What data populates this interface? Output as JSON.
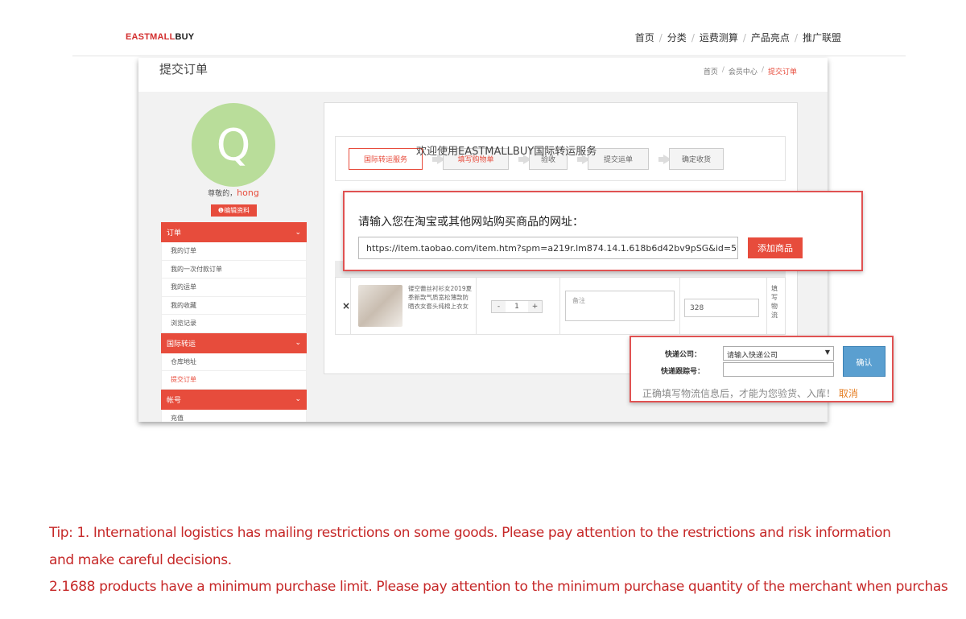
{
  "brand": {
    "part1": "EASTMALL",
    "part2": "BUY",
    "accent": "#d32f2f"
  },
  "nav": {
    "items": [
      "首页",
      "分类",
      "运费测算",
      "产品亮点",
      "推广联盟"
    ]
  },
  "shot": {
    "page_title": "提交订单",
    "breadcrumb": [
      "首页",
      "会员中心",
      "提交订单"
    ],
    "avatar_letter": "Q",
    "greeting": "尊敬的，",
    "username": "hong",
    "edit_button": "❶编辑资料",
    "sidebar": {
      "orders_header": "订单",
      "orders_items": [
        "我的订单",
        "我的一次付款订单",
        "我的运单",
        "我的收藏",
        "浏览记录"
      ],
      "forward_header": "国际转运",
      "forward_items": [
        "仓库地址",
        "提交订单"
      ],
      "account_header": "帐号",
      "account_items": [
        "充值"
      ]
    },
    "welcome": "欢迎使用EASTMALLBUY国际转运服务",
    "steps": [
      "国际转运服务",
      "填写购物单",
      "验收",
      "提交运单",
      "确定收货"
    ],
    "product": {
      "name": "镂空蕾丝衬衫女2019夏季新款气质宽松薄款防晒衣女套头纯棉上衣女",
      "qty": "1",
      "minus": "-",
      "plus": "+",
      "remark_placeholder": "备注",
      "price": "328",
      "fill_logistics": "填写物流",
      "remove": "×"
    }
  },
  "url_popup": {
    "question": "请输入您在淘宝或其他网站购买商品的网址：",
    "url": "https://item.taobao.com/item.htm?spm=a219r.lm874.14.1.618b6d42bv9pSG&id=59",
    "add_button": "添加商品"
  },
  "ship_popup": {
    "company_label": "快递公司：",
    "tracking_label": "快递跟踪号：",
    "company_placeholder": "请输入快递公司",
    "confirm": "确认",
    "hint": "正确填写物流信息后，才能为您验货、入库！",
    "cancel": "取消"
  },
  "tips": {
    "line1": "Tip: 1. International logistics has mailing restrictions on some goods. Please pay attention to the restrictions and risk information",
    "line2": "and make careful decisions.",
    "line3": "2.1688 products have a minimum purchase limit. Please pay attention to the minimum purchase quantity of the merchant when purchas"
  },
  "colors": {
    "accent_red": "#e74c3c",
    "tip_red": "#c62828",
    "avatar_green": "#b9dd9a",
    "confirm_blue": "#5a9fd0"
  }
}
